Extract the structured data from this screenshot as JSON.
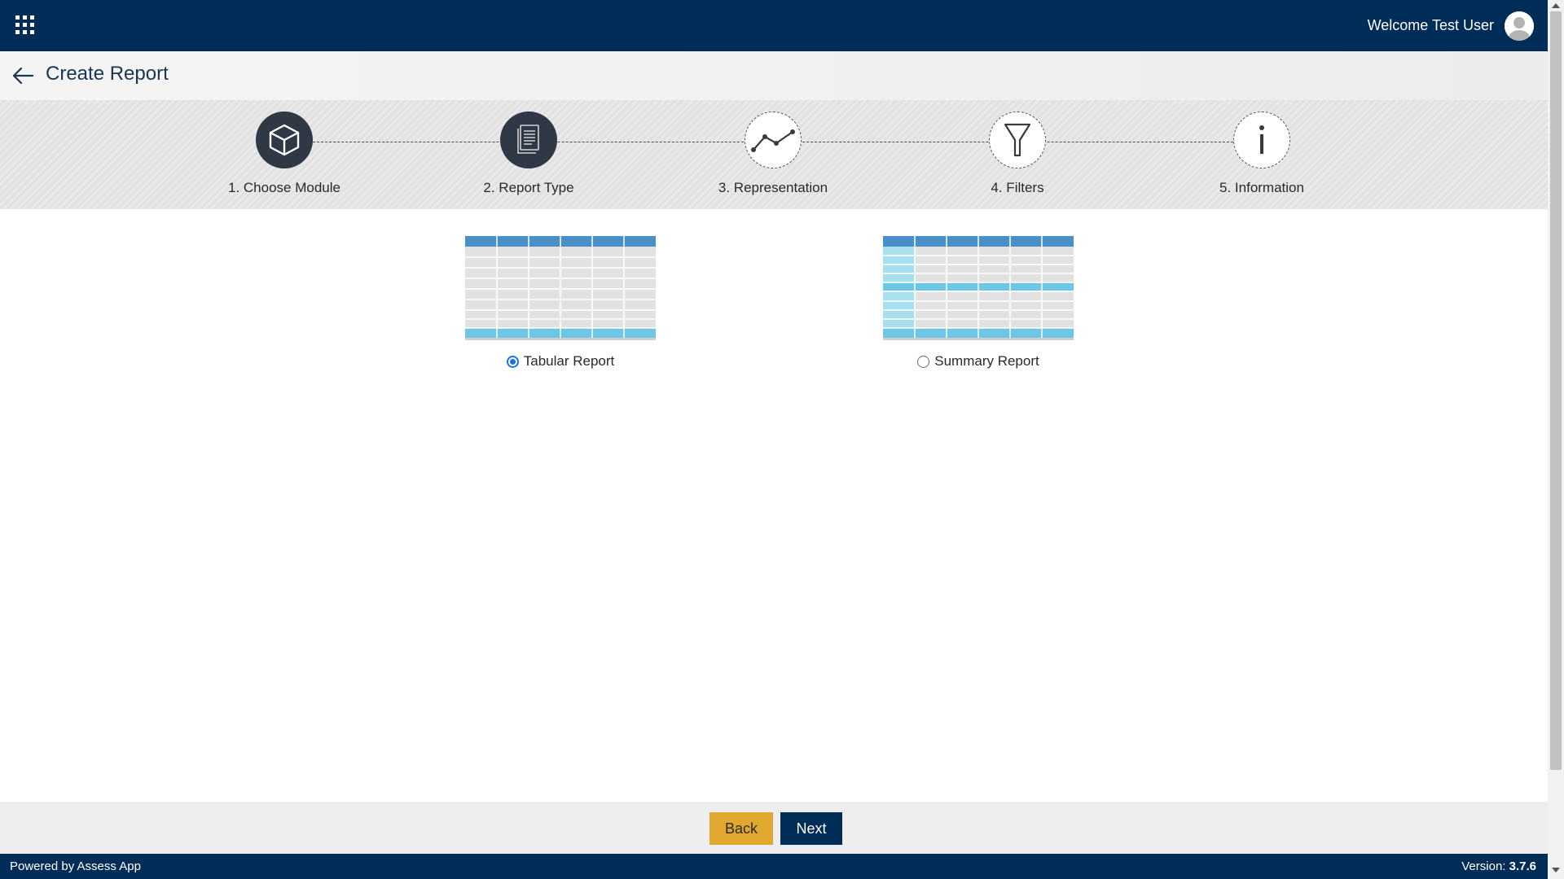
{
  "header": {
    "welcome": "Welcome Test User",
    "apps_icon": "grid-apps-icon",
    "avatar_icon": "user-avatar-icon"
  },
  "titlebar": {
    "title": "Create Report",
    "back_icon": "arrow-left-icon"
  },
  "steps": [
    {
      "label": "1. Choose Module",
      "icon": "cube-icon",
      "status": "completed"
    },
    {
      "label": "2. Report Type",
      "icon": "document-icon",
      "status": "completed"
    },
    {
      "label": "3. Representation",
      "icon": "line-chart-icon",
      "status": "pending"
    },
    {
      "label": "4. Filters",
      "icon": "filter-icon",
      "status": "pending"
    },
    {
      "label": "5. Information",
      "icon": "info-icon",
      "status": "pending"
    }
  ],
  "report_types": [
    {
      "label": "Tabular Report",
      "selected": true
    },
    {
      "label": "Summary Report",
      "selected": false
    }
  ],
  "buttons": {
    "back": "Back",
    "next": "Next"
  },
  "footer": {
    "powered": "Powered by Assess App",
    "version_label": "Version: ",
    "version_value": "3.7.6"
  },
  "colors": {
    "navy": "#002d57",
    "gold": "#e0a82e",
    "step_dark": "#2f3844",
    "grid_header": "#4a90c8",
    "grid_highlight": "#6cc6e4"
  }
}
